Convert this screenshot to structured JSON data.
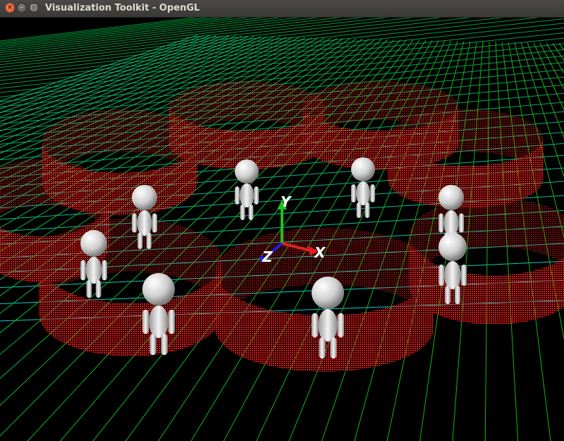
{
  "window": {
    "title": "Visualization Toolkit - OpenGL",
    "controls": {
      "close": "×",
      "minimize": "–",
      "maximize": "□"
    }
  },
  "scene": {
    "background": "#000000",
    "arc_color": "#ff1a1a",
    "figure_color": "#e8e8e8",
    "figure_count": 8,
    "axes": {
      "x_label": "X",
      "y_label": "Y",
      "z_label": "Z",
      "x_color": "#e02020",
      "y_color": "#20c020",
      "z_color": "#2020e0"
    }
  }
}
